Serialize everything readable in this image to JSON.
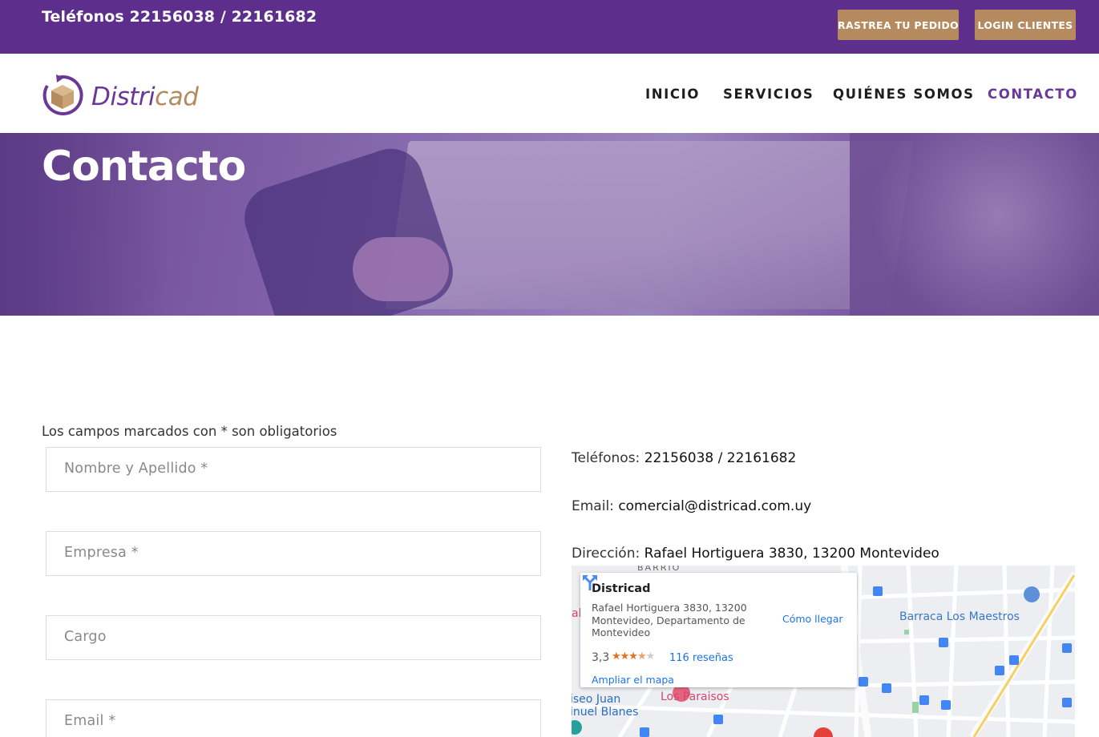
{
  "topbar": {
    "phones": "Teléfonos 22156038 / 22161682",
    "track_button": "RASTREA TU PEDIDO",
    "login_button": "LOGIN CLIENTES",
    "bg_color": "#5e2e8c",
    "button_color": "#b58a5e"
  },
  "header": {
    "logo_part1": "Distri",
    "logo_part2": "cad",
    "nav": [
      {
        "label": "INICIO"
      },
      {
        "label": "SERVICIOS"
      },
      {
        "label": "QUIÉNES SOMOS"
      },
      {
        "label": "CONTACTO",
        "active": true
      }
    ]
  },
  "hero": {
    "title": "Contacto"
  },
  "form": {
    "required_note": "Los campos marcados con * son obligatorios",
    "fields": [
      {
        "placeholder": "Nombre y Apellido *"
      },
      {
        "placeholder": "Empresa *"
      },
      {
        "placeholder": "Cargo"
      },
      {
        "placeholder": "Email *"
      }
    ]
  },
  "contact": {
    "phones_label": "Teléfonos:",
    "phones_value": "22156038 / 22161682",
    "email_label": "Email:",
    "email_value": "comercial@districad.com.uy",
    "address_label": "Dirección:",
    "address_value": "Rafael Hortiguera 3830, 13200 Montevideo"
  },
  "map": {
    "card": {
      "title": "Districad",
      "address": "Rafael Hortiguera 3830, 13200 Montevideo, Departamento de Montevideo",
      "rating": "3,3",
      "stars_on": "★★★",
      "stars_half": "★",
      "stars_off": "★",
      "reviews": "116 reseñas",
      "enlarge": "Ampliar el mapa",
      "directions": "Cómo llegar"
    },
    "labels": {
      "barraca": "Barraca Los Maestros",
      "paraisos": "Los Paraisos",
      "juan": "iseo Juan",
      "blanes": "inuel Blanes",
      "barrio": "BARRIO",
      "al": "al"
    }
  }
}
